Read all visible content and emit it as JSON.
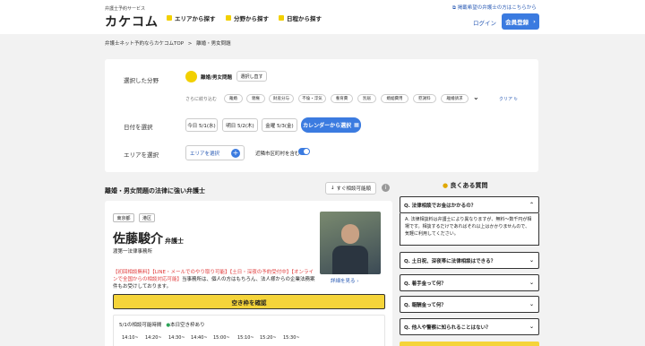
{
  "header": {
    "brand_sub": "弁護士予約サービス",
    "logo": "カケコム",
    "nav": [
      "エリアから探す",
      "分野から探す",
      "日程から探す"
    ],
    "registration_note": "掲載希望の弁護士の方はこちらから",
    "login": "ログイン",
    "signup": "会員登録",
    "signup_chevron": "›"
  },
  "breadcrumb": {
    "home": "弁護士ネット予約ならカケコムTOP",
    "sep": ">",
    "current": "離婚・男女問題"
  },
  "filters": {
    "field_label": "選択した分野",
    "selected_field": "離婚/男女問題",
    "reselect": "選択し直す",
    "narrow_label": "さらに絞り込む",
    "sub_chips": [
      "離婚",
      "親権",
      "財産分与",
      "不倫・浮気",
      "養育費",
      "別居",
      "婚姻費用",
      "慰謝料",
      "離婚請求"
    ],
    "more_chevron": "⌄",
    "clear": "クリア",
    "date_label": "日付を選択",
    "dates": [
      "今日 5/1(水)",
      "明日 5/2(木)",
      "金曜 5/3(金)"
    ],
    "calendar_btn": "カレンダーから選択",
    "area_label": "エリアを選択",
    "area_select": "エリアを選択",
    "nearby_label": "近隣市区町村を含む",
    "nearby_on": true
  },
  "results": {
    "heading": "離婚・男女問題の法律に強い弁護士",
    "instant_filter": "すぐ相談可能順"
  },
  "lawyer": {
    "prefecture": "東京都",
    "ward": "港区",
    "name": "佐藤駿介",
    "title": "弁護士",
    "office": "渡第一法律事務所",
    "intro_red": "【初回相談無料】【LINE・メールでのやり取り可能】【土日・深夜の予約受付中】【オンラインで全国からの相談対応可能】",
    "intro_black": "当事務所は、個人の方はもちろん、法人様からの企業法務案件もお受けしております。",
    "detail_link": "詳細を見る",
    "cta": "空き枠を確認",
    "slot_date": "5/1の相談可能時間",
    "slot_today": "本日空き枠あり",
    "times": [
      "14:10~",
      "14:20~",
      "14:30~",
      "14:40~",
      "15:00~",
      "15:10~",
      "15:20~",
      "15:30~"
    ]
  },
  "faq": {
    "heading": "良くある質問",
    "items": [
      {
        "q": "Q. 法律相談でお金はかかるの？",
        "answer": "A. 法律相談料は弁護士により異なりますが、無料〜数千円が相場です。相談するだけであればそれ以上はかかりませんので、気軽に利用してください。"
      },
      {
        "q": "Q. 土日祝、深夜帯に法律相談はできる？"
      },
      {
        "q": "Q. 着手金って何？"
      },
      {
        "q": "Q. 報酬金って何？"
      },
      {
        "q": "Q. 他人や警察に知られることはない？"
      }
    ]
  },
  "colors": {
    "accent": "#3b7be0",
    "highlight": "#f2d000",
    "cta": "#f5d43a",
    "red": "#e03a3a",
    "green": "#2ea35a"
  }
}
